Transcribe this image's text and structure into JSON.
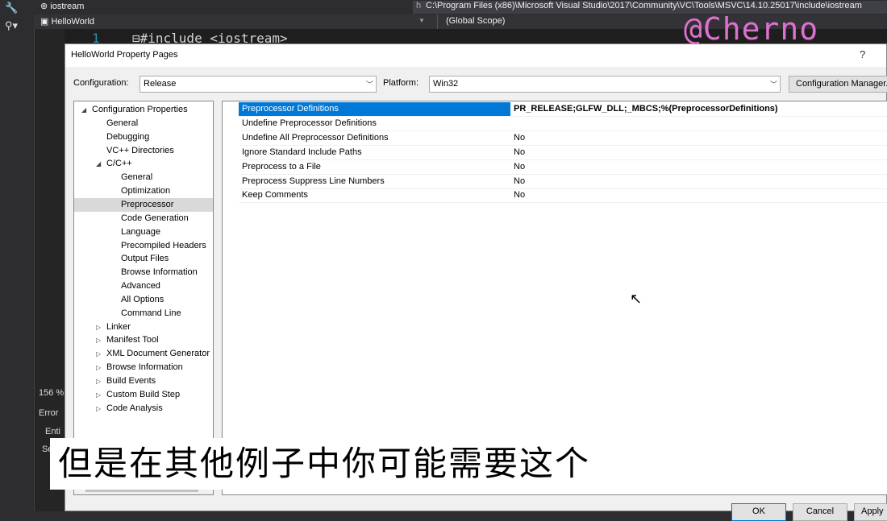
{
  "vs": {
    "tab_file": "iostream",
    "path": "C:\\Program Files (x86)\\Microsoft Visual Studio\\2017\\Community\\VC\\Tools\\MSVC\\14.10.25017\\include\\iostream",
    "path_prefix": "h",
    "nav_project": "HelloWorld",
    "nav_scope": "(Global Scope)",
    "line_number": "1",
    "code_line": "⊟#include <iostream>",
    "zoom": "156 %",
    "error_label": "Error",
    "entire_label": "Enti",
    "se_label": "Se"
  },
  "watermark": "@Cherno",
  "dialog": {
    "title": "HelloWorld Property Pages",
    "help": "?",
    "config_label": "Configuration:",
    "config_value": "Release",
    "platform_label": "Platform:",
    "platform_value": "Win32",
    "config_manager": "Configuration Manager...",
    "tree": [
      {
        "label": "Configuration Properties",
        "level": 0,
        "toggle": "◢"
      },
      {
        "label": "General",
        "level": 1,
        "toggle": ""
      },
      {
        "label": "Debugging",
        "level": 1,
        "toggle": ""
      },
      {
        "label": "VC++ Directories",
        "level": 1,
        "toggle": ""
      },
      {
        "label": "C/C++",
        "level": 1,
        "toggle": "◢"
      },
      {
        "label": "General",
        "level": 2,
        "toggle": ""
      },
      {
        "label": "Optimization",
        "level": 2,
        "toggle": ""
      },
      {
        "label": "Preprocessor",
        "level": 2,
        "toggle": "",
        "selected": true
      },
      {
        "label": "Code Generation",
        "level": 2,
        "toggle": ""
      },
      {
        "label": "Language",
        "level": 2,
        "toggle": ""
      },
      {
        "label": "Precompiled Headers",
        "level": 2,
        "toggle": ""
      },
      {
        "label": "Output Files",
        "level": 2,
        "toggle": ""
      },
      {
        "label": "Browse Information",
        "level": 2,
        "toggle": ""
      },
      {
        "label": "Advanced",
        "level": 2,
        "toggle": ""
      },
      {
        "label": "All Options",
        "level": 2,
        "toggle": ""
      },
      {
        "label": "Command Line",
        "level": 2,
        "toggle": ""
      },
      {
        "label": "Linker",
        "level": 1,
        "toggle": "▷"
      },
      {
        "label": "Manifest Tool",
        "level": 1,
        "toggle": "▷"
      },
      {
        "label": "XML Document Generator",
        "level": 1,
        "toggle": "▷"
      },
      {
        "label": "Browse Information",
        "level": 1,
        "toggle": "▷"
      },
      {
        "label": "Build Events",
        "level": 1,
        "toggle": "▷"
      },
      {
        "label": "Custom Build Step",
        "level": 1,
        "toggle": "▷"
      },
      {
        "label": "Code Analysis",
        "level": 1,
        "toggle": "▷"
      }
    ],
    "properties": [
      {
        "name": "Preprocessor Definitions",
        "value": "PR_RELEASE;GLFW_DLL;_MBCS;%(PreprocessorDefinitions)",
        "selected": true,
        "bold": true
      },
      {
        "name": "Undefine Preprocessor Definitions",
        "value": ""
      },
      {
        "name": "Undefine All Preprocessor Definitions",
        "value": "No"
      },
      {
        "name": "Ignore Standard Include Paths",
        "value": "No"
      },
      {
        "name": "Preprocess to a File",
        "value": "No"
      },
      {
        "name": "Preprocess Suppress Line Numbers",
        "value": "No"
      },
      {
        "name": "Keep Comments",
        "value": "No"
      }
    ],
    "ok": "OK",
    "cancel": "Cancel",
    "apply": "Apply"
  },
  "subtitle": "但是在其他例子中你可能需要这个"
}
